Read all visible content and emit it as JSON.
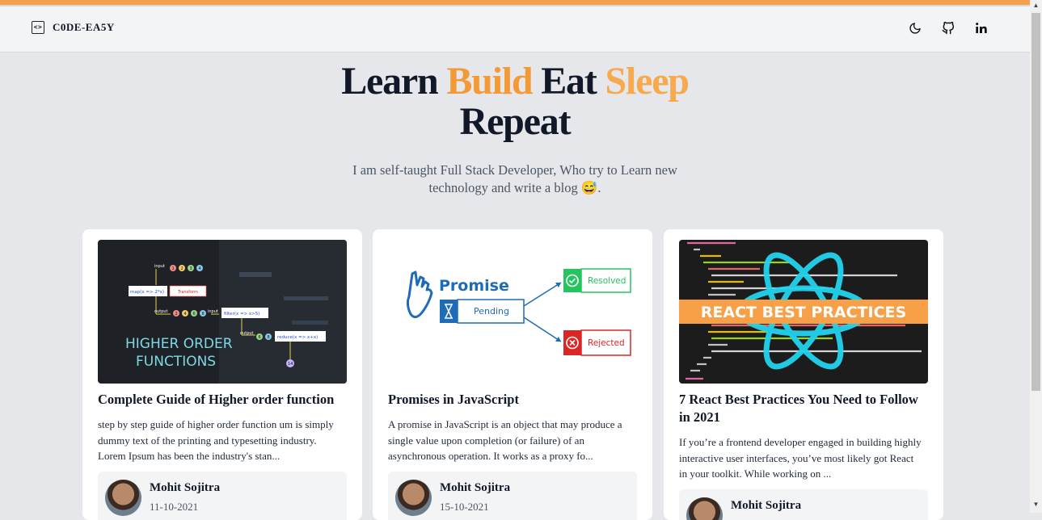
{
  "brand": {
    "name": "C0DE-EA5Y",
    "icon": "code-icon"
  },
  "nav": {
    "icons": [
      "moon-icon",
      "github-icon",
      "linkedin-icon"
    ]
  },
  "hero": {
    "title_part1": "Learn",
    "title_part2": "Build",
    "title_part3": "Eat",
    "title_part4": "Sleep",
    "title_part5": "Repeat",
    "subtitle": "I am self-taught Full Stack Developer, Who try to Learn new technology and write a blog 😅.",
    "accent_color": "#f39a34"
  },
  "posts": [
    {
      "title": "Complete Guide of Higher order function",
      "description": "step by step guide of higher order function um is simply dummy text of the printing and typesetting industry. Lorem Ipsum has been the industry's stan...",
      "author": "Mohit Sojitra",
      "date": "11-10-2021",
      "image_text": {
        "line1": "HIGHER ORDER",
        "line2": "FUNCTIONS",
        "input1": "input",
        "map": "map(x => 2*x)",
        "transform": "Transform",
        "output1": "output",
        "input2": "input",
        "filter": "filter(x => x>5)",
        "output2": "output",
        "reduce": "reduce(x => x+x)",
        "n1": "1",
        "n2": "2",
        "n3": "3",
        "n4": "4",
        "m1": "2",
        "m2": "4",
        "m3": "6",
        "m4": "8",
        "f1": "6",
        "f2": "8",
        "r": "14"
      }
    },
    {
      "title": "Promises in JavaScript",
      "description": "A promise in JavaScript is an object that may produce a single value upon completion (or failure) of an asynchronous operation. It works as a proxy fo...",
      "author": "Mohit Sojitra",
      "date": "15-10-2021",
      "image_text": {
        "promise": "Promise",
        "pending": "Pending",
        "resolved": "Resolved",
        "rejected": "Rejected"
      }
    },
    {
      "title": "7 React Best Practices You Need to Follow in 2021",
      "description": "If you’re a frontend developer engaged in building highly interactive user interfaces, you’ve most likely got React in your toolkit. While working on ...",
      "author": "Mohit Sojitra",
      "date": "",
      "image_text": {
        "banner": "REACT BEST PRACTICES"
      }
    }
  ]
}
